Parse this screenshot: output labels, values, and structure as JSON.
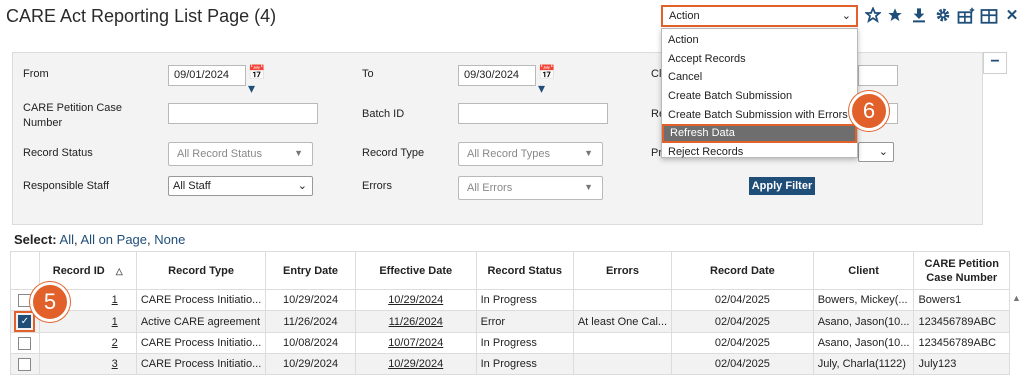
{
  "header": {
    "title": "CARE Act Reporting List Page (4)",
    "action_label": "Action",
    "icons": [
      "star-outline-icon",
      "star-icon",
      "download-icon",
      "gear-icon",
      "add-table-icon",
      "table-icon",
      "close-icon"
    ]
  },
  "action_menu": {
    "items": [
      "Action",
      "Accept Records",
      "Cancel",
      "Create Batch Submission",
      "Create Batch Submission with Errors",
      "Refresh Data",
      "Reject Records"
    ],
    "highlighted_index": 5
  },
  "callouts": {
    "five": "5",
    "six": "6"
  },
  "filters": {
    "from_label": "From",
    "from_value": "09/01/2024",
    "to_label": "To",
    "to_value": "09/30/2024",
    "client_label_partial": "Cl",
    "petition_label_line1": "CARE Petition Case",
    "petition_label_line2": "Number",
    "batch_label": "Batch ID",
    "re_label_partial": "Re",
    "record_status_label": "Record Status",
    "record_status_placeholder": "All Record Status",
    "record_type_label": "Record Type",
    "record_type_placeholder": "All Record Types",
    "pr_label_partial": "Pr",
    "responsible_label": "Responsible Staff",
    "responsible_value": "All Staff",
    "errors_label": "Errors",
    "errors_placeholder": "All Errors",
    "apply_label": "Apply Filter",
    "collapse_symbol": "−"
  },
  "select_links": {
    "label": "Select:",
    "all": "All",
    "all_on_page": "All on Page",
    "none": "None"
  },
  "table": {
    "headers": [
      "Record ID",
      "Record Type",
      "Entry Date",
      "Effective Date",
      "Record Status",
      "Errors",
      "Record Date",
      "Client",
      "CARE Petition Case Number"
    ],
    "rows": [
      {
        "checked": false,
        "id": "1",
        "type": "CARE Process Initiatio...",
        "entry": "10/29/2024",
        "effective": "10/29/2024",
        "status": "In Progress",
        "errors": "",
        "record_date": "02/04/2025",
        "client": "Bowers, Mickey(...",
        "petition": "Bowers1"
      },
      {
        "checked": true,
        "id": "1",
        "type": "Active CARE agreement",
        "entry": "11/26/2024",
        "effective": "11/26/2024",
        "status": "Error",
        "errors": "At least One Cal...",
        "record_date": "02/04/2025",
        "client": "Asano, Jason(10...",
        "petition": "123456789ABC"
      },
      {
        "checked": false,
        "id": "2",
        "type": "CARE Process Initiatio...",
        "entry": "10/08/2024",
        "effective": "10/07/2024",
        "status": "In Progress",
        "errors": "",
        "record_date": "02/04/2025",
        "client": "Asano, Jason(10...",
        "petition": "123456789ABC"
      },
      {
        "checked": false,
        "id": "3",
        "type": "CARE Process Initiatio...",
        "entry": "10/29/2024",
        "effective": "10/29/2024",
        "status": "In Progress",
        "errors": "",
        "record_date": "02/04/2025",
        "client": "July, Charla(1122)",
        "petition": "July123"
      }
    ]
  },
  "colors": {
    "accent": "#e2612a",
    "brand": "#1f4e79"
  }
}
